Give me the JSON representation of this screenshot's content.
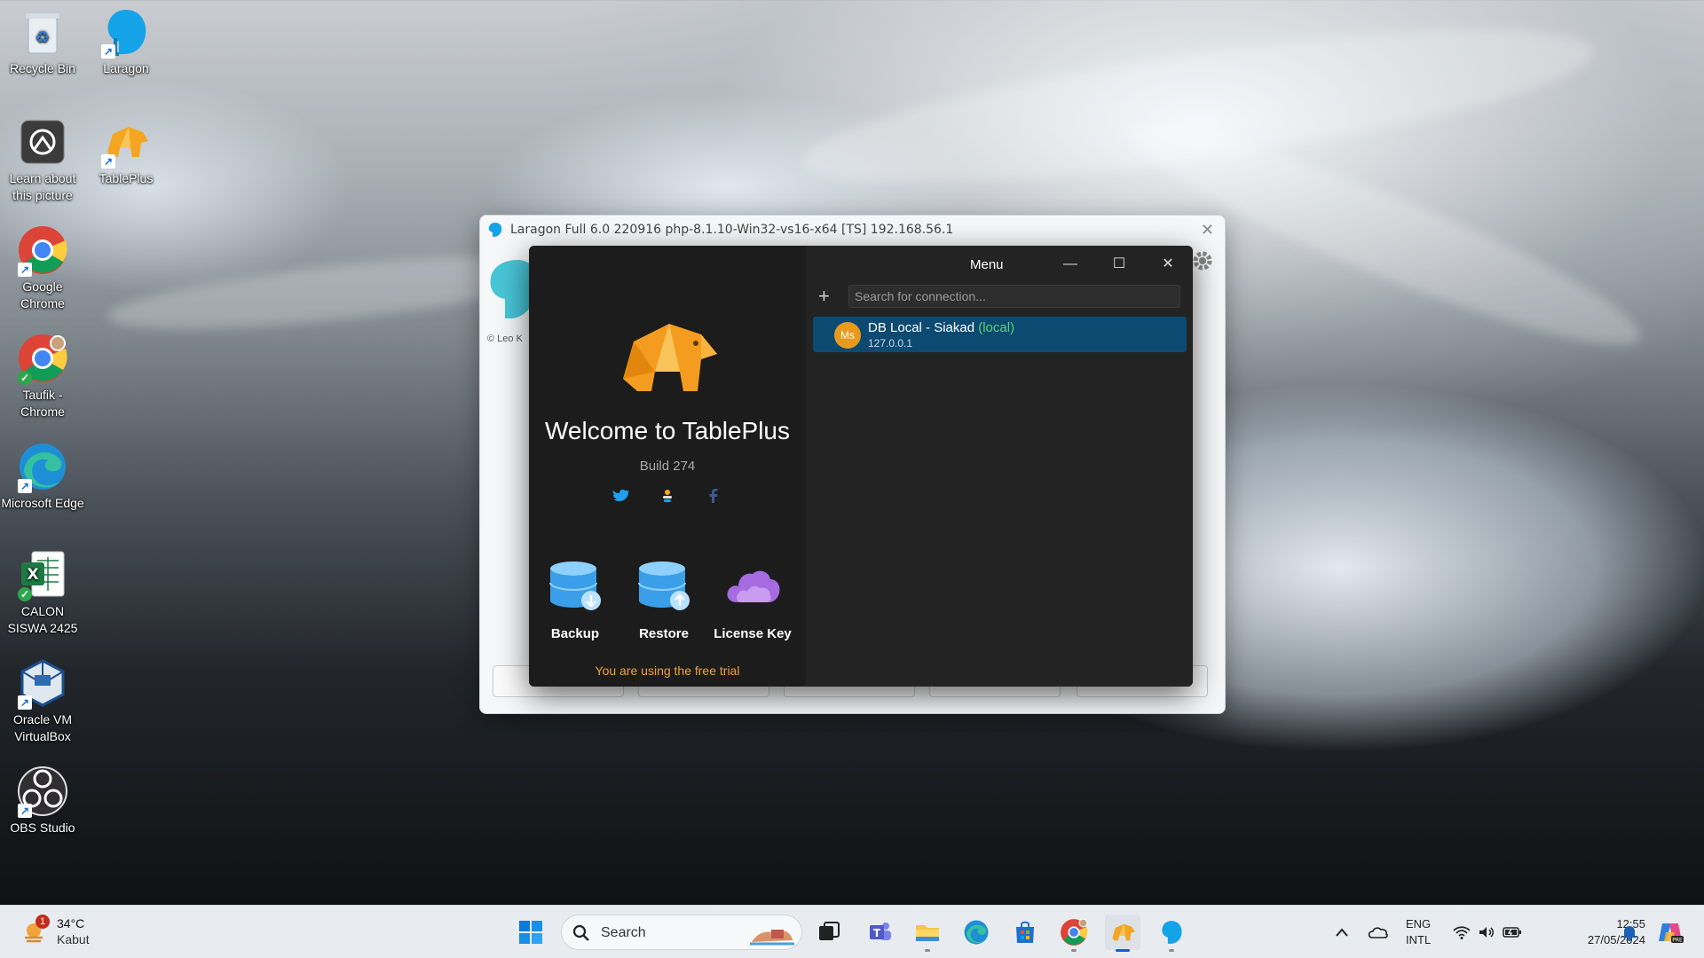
{
  "desktop": {
    "icons": [
      {
        "label": "Recycle Bin"
      },
      {
        "label": "Laragon"
      },
      {
        "label": "Learn about this picture"
      },
      {
        "label": "TablePlus"
      },
      {
        "label": "Google Chrome"
      },
      {
        "label": "Taufik - Chrome"
      },
      {
        "label": "Microsoft Edge"
      },
      {
        "label": "CALON SISWA 2425"
      },
      {
        "label": "Oracle VM VirtualBox"
      },
      {
        "label": "OBS Studio"
      }
    ]
  },
  "laragon": {
    "title": "Laragon Full 6.0 220916 php-8.1.10-Win32-vs16-x64 [TS]  192.168.56.1",
    "copyright": "© Leo K"
  },
  "tableplus": {
    "welcome": "Welcome to TablePlus",
    "build": "Build 274",
    "actions": [
      {
        "label": "Backup"
      },
      {
        "label": "Restore"
      },
      {
        "label": "License Key"
      }
    ],
    "trial_notice": "You are using the free trial",
    "menu_label": "Menu",
    "search_placeholder": "Search for connection...",
    "connection": {
      "badge": "Ms",
      "name": "DB Local - Siakad",
      "env": "(local)",
      "host": "127.0.0.1"
    }
  },
  "taskbar": {
    "weather": {
      "alert_count": "1",
      "temp": "34°C",
      "condition": "Kabut"
    },
    "search_label": "Search",
    "lang_line1": "ENG",
    "lang_line2": "INTL",
    "time": "12:55",
    "date": "27/05/2024"
  },
  "colors": {
    "accent": "#0a64c8",
    "selection": "#0c4a72",
    "local_env": "#5ed36a",
    "trial": "#f0a23a"
  }
}
